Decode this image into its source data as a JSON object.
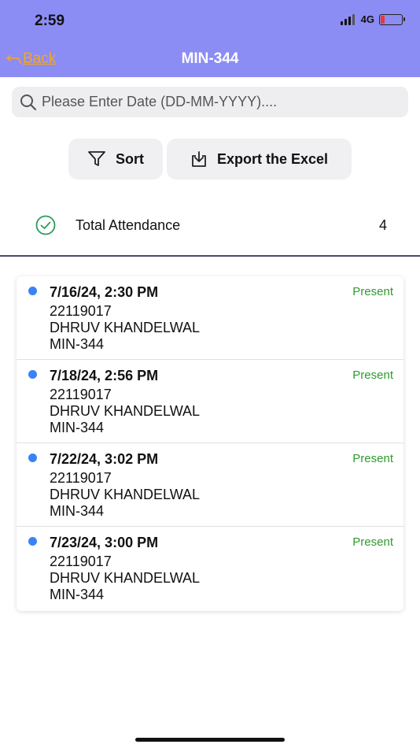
{
  "status_bar": {
    "time": "2:59",
    "network": "4G"
  },
  "nav": {
    "back_label": "Back",
    "title": "MIN-344"
  },
  "search": {
    "placeholder": "Please Enter Date (DD-MM-YYYY)...."
  },
  "actions": {
    "sort_label": "Sort",
    "export_label": "Export the Excel"
  },
  "summary": {
    "label": "Total Attendance",
    "count": "4"
  },
  "records": [
    {
      "datetime": "7/16/24, 2:30 PM",
      "roll": "22119017",
      "name": "DHRUV KHANDELWAL",
      "code": "MIN-344",
      "status": "Present"
    },
    {
      "datetime": "7/18/24, 2:56 PM",
      "roll": "22119017",
      "name": "DHRUV KHANDELWAL",
      "code": "MIN-344",
      "status": "Present"
    },
    {
      "datetime": "7/22/24, 3:02 PM",
      "roll": "22119017",
      "name": "DHRUV KHANDELWAL",
      "code": "MIN-344",
      "status": "Present"
    },
    {
      "datetime": "7/23/24, 3:00 PM",
      "roll": "22119017",
      "name": "DHRUV KHANDELWAL",
      "code": "MIN-344",
      "status": "Present"
    }
  ],
  "colors": {
    "header": "#8c8cf5",
    "back_link": "#f5a623",
    "present": "#2e9a2e",
    "dot": "#3a82f7"
  },
  "icons": [
    "signal-icon",
    "battery-icon",
    "back-arrow-icon",
    "search-icon",
    "filter-icon",
    "download-icon",
    "check-circle-icon"
  ]
}
